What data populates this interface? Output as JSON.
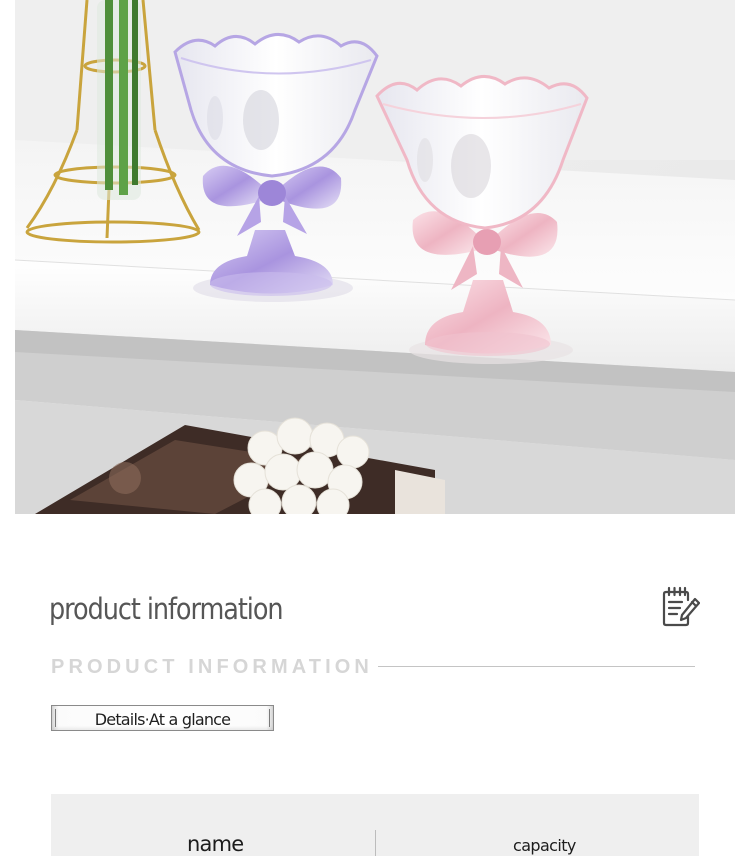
{
  "product_photo": {
    "subject": "Two iridescent ceramic bow-tie dessert cups on a white shelf",
    "colors": {
      "cup_left": "#b9a7e6",
      "cup_right": "#f3c4cf",
      "shelf": "#f7f7f7",
      "vase_frame": "#c9a43d"
    }
  },
  "section": {
    "title": "product information",
    "subtitle": "PRODUCT INFORMATION",
    "tag": "Details·At a glance",
    "icon": "notepad-edit-icon"
  },
  "table": {
    "headers": [
      "name",
      "capacity"
    ]
  },
  "colors": {
    "title": "#565656",
    "subtitle": "#d6d6d6",
    "table_bg": "#efefef"
  }
}
